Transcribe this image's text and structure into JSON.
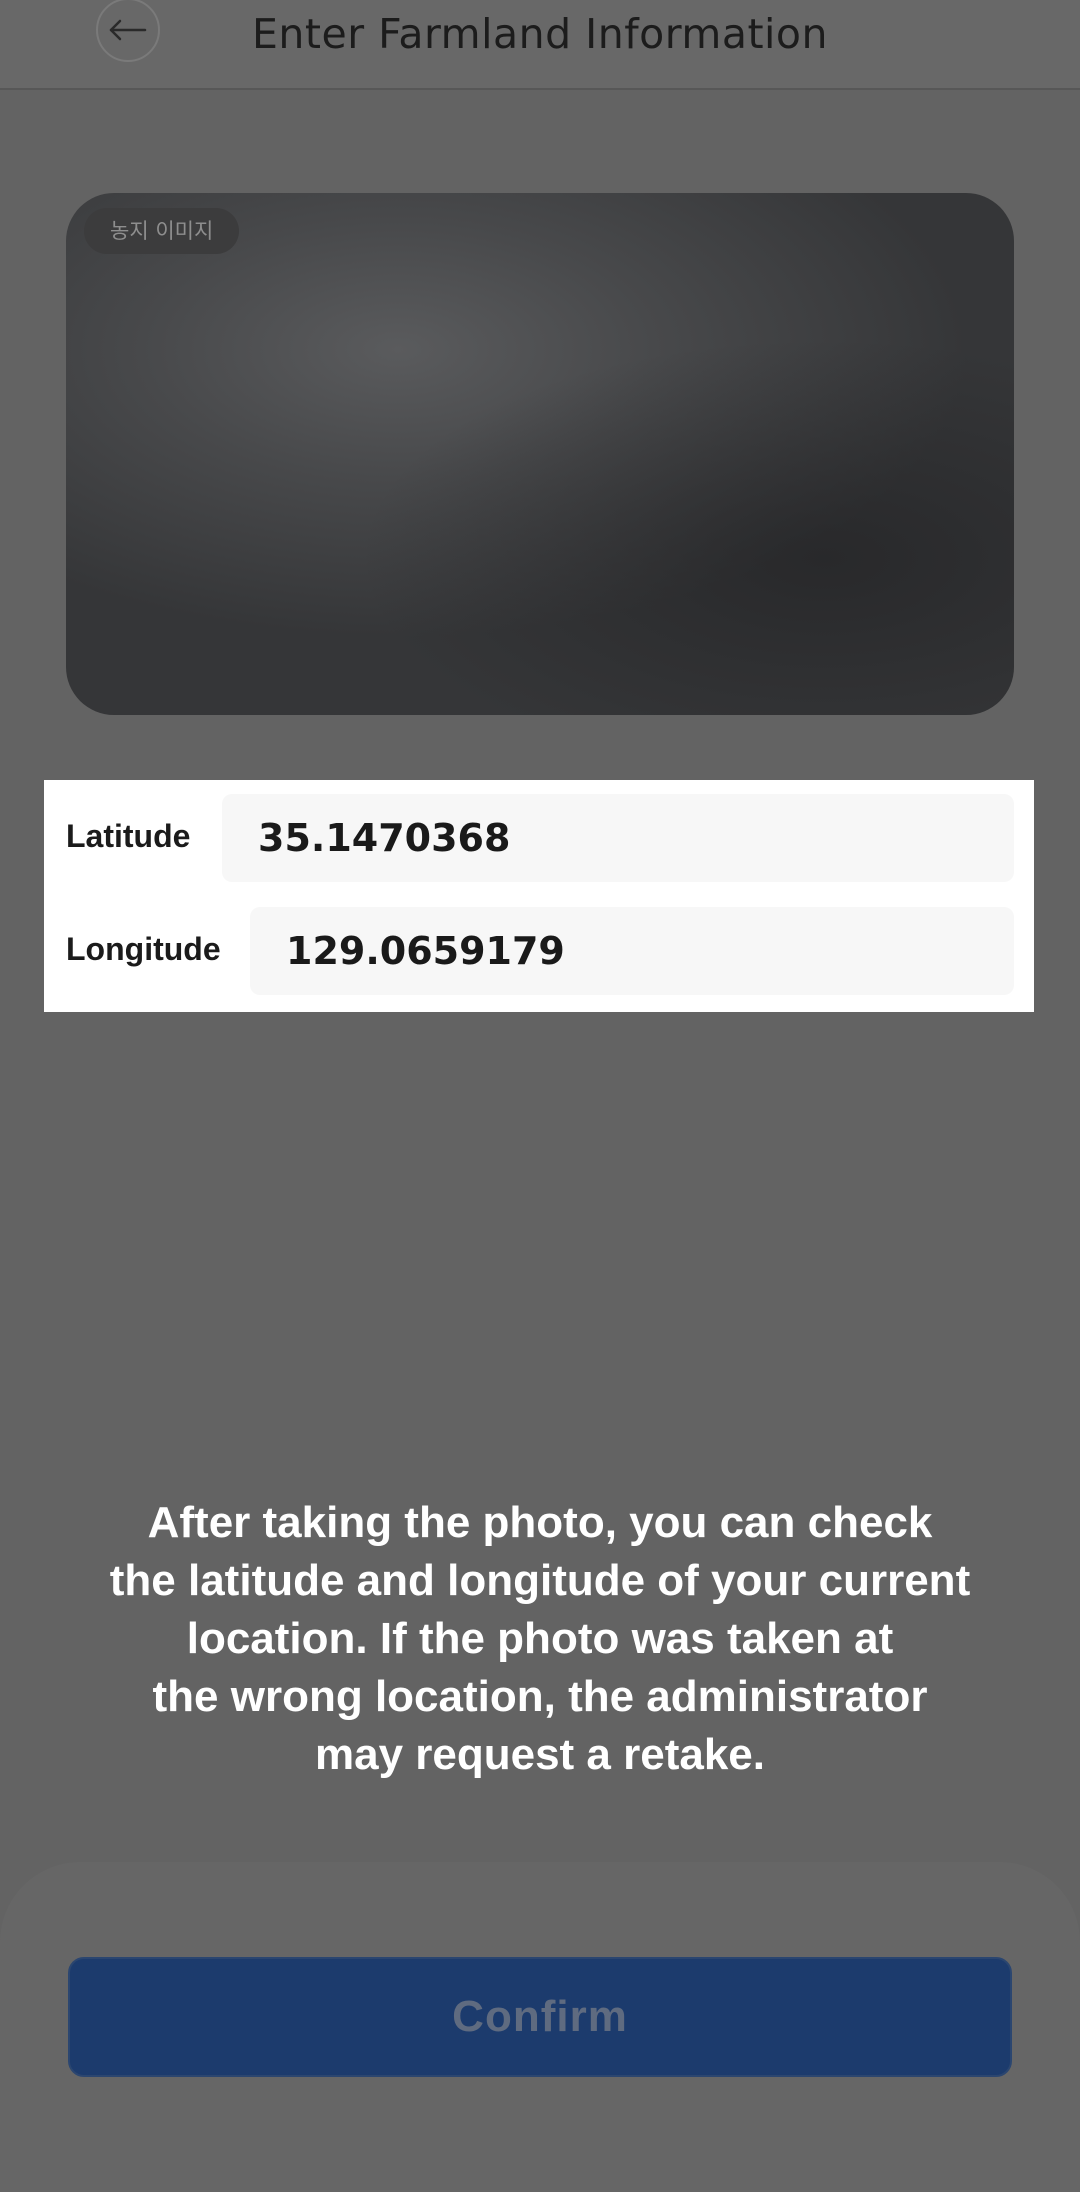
{
  "header": {
    "title": "Enter Farmland Information",
    "back_icon": "arrow-left-icon"
  },
  "photo": {
    "badge": "농지 이미지"
  },
  "coordinates": {
    "latitude_label": "Latitude",
    "latitude_value": "35.1470368",
    "longitude_label": "Longitude",
    "longitude_value": "129.0659179"
  },
  "notice": {
    "text": "After taking the photo, you can check\nthe latitude and longitude of your current\nlocation. If the photo was taken at\nthe wrong location, the administrator\nmay request a retake."
  },
  "footer": {
    "confirm_label": "Confirm",
    "confirm_color": "#1c3b6d"
  }
}
